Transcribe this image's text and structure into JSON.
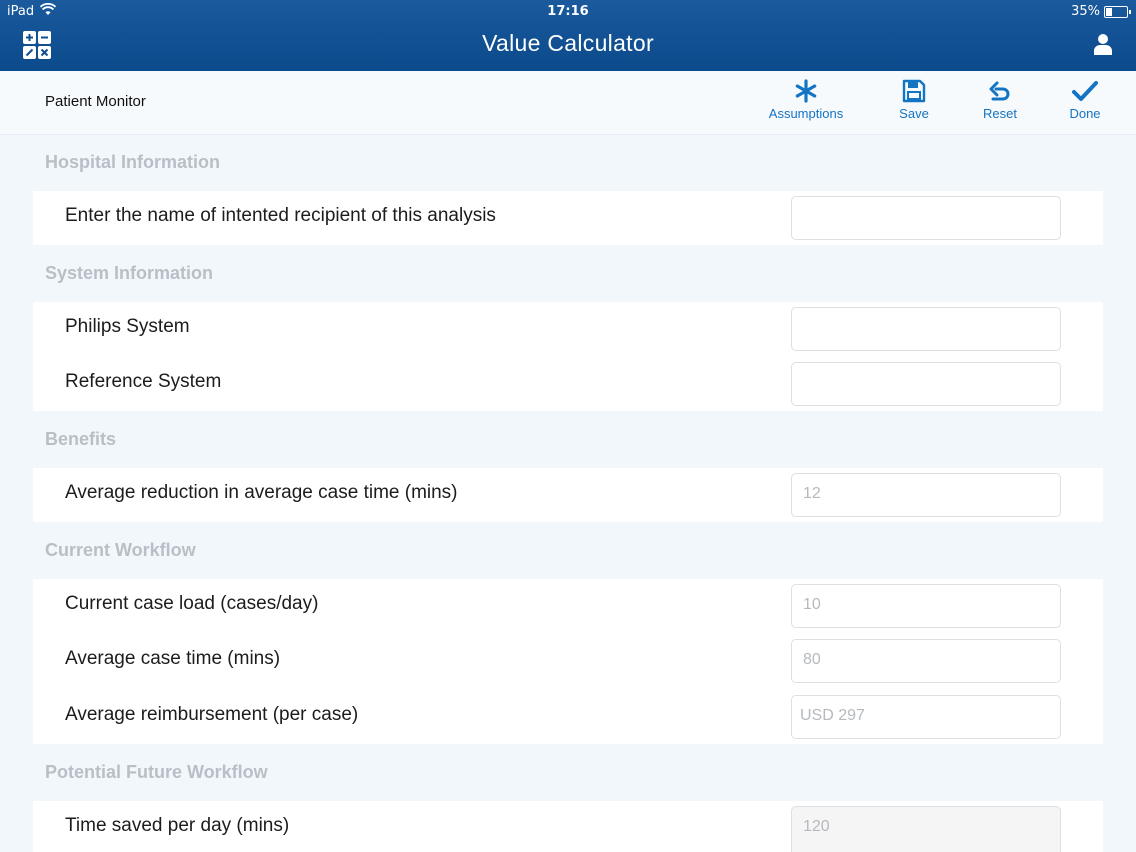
{
  "status_bar": {
    "carrier": "iPad",
    "time": "17:16",
    "battery": "35%"
  },
  "header": {
    "title": "Value Calculator",
    "left_icon": "calculator-icon",
    "right_icon": "user-icon"
  },
  "toolbar": {
    "product": "Patient Monitor",
    "assumptions_label": "Assumptions",
    "save_label": "Save",
    "reset_label": "Reset",
    "done_label": "Done",
    "accent": "#1474c4"
  },
  "sections": {
    "hospital": {
      "title": "Hospital Information",
      "recipient_label": "Enter the name of intented recipient of this analysis",
      "recipient_value": ""
    },
    "system": {
      "title": "System Information",
      "philips_label": "Philips System",
      "philips_value": "",
      "reference_label": "Reference System",
      "reference_value": ""
    },
    "benefits": {
      "title": "Benefits",
      "reduction_label": "Average reduction in average case time  (mins)",
      "reduction_placeholder": "12"
    },
    "current": {
      "title": "Current Workflow",
      "case_load_label": "Current case load (cases/day)",
      "case_load_placeholder": "10",
      "case_time_label": "Average case time (mins)",
      "case_time_placeholder": "80",
      "reimbursement_label": "Average reimbursement (per case)",
      "reimbursement_placeholder": "USD 297"
    },
    "future": {
      "title": "Potential Future Workflow",
      "time_saved_label": "Time saved per day (mins)",
      "time_saved_value": "120"
    }
  }
}
